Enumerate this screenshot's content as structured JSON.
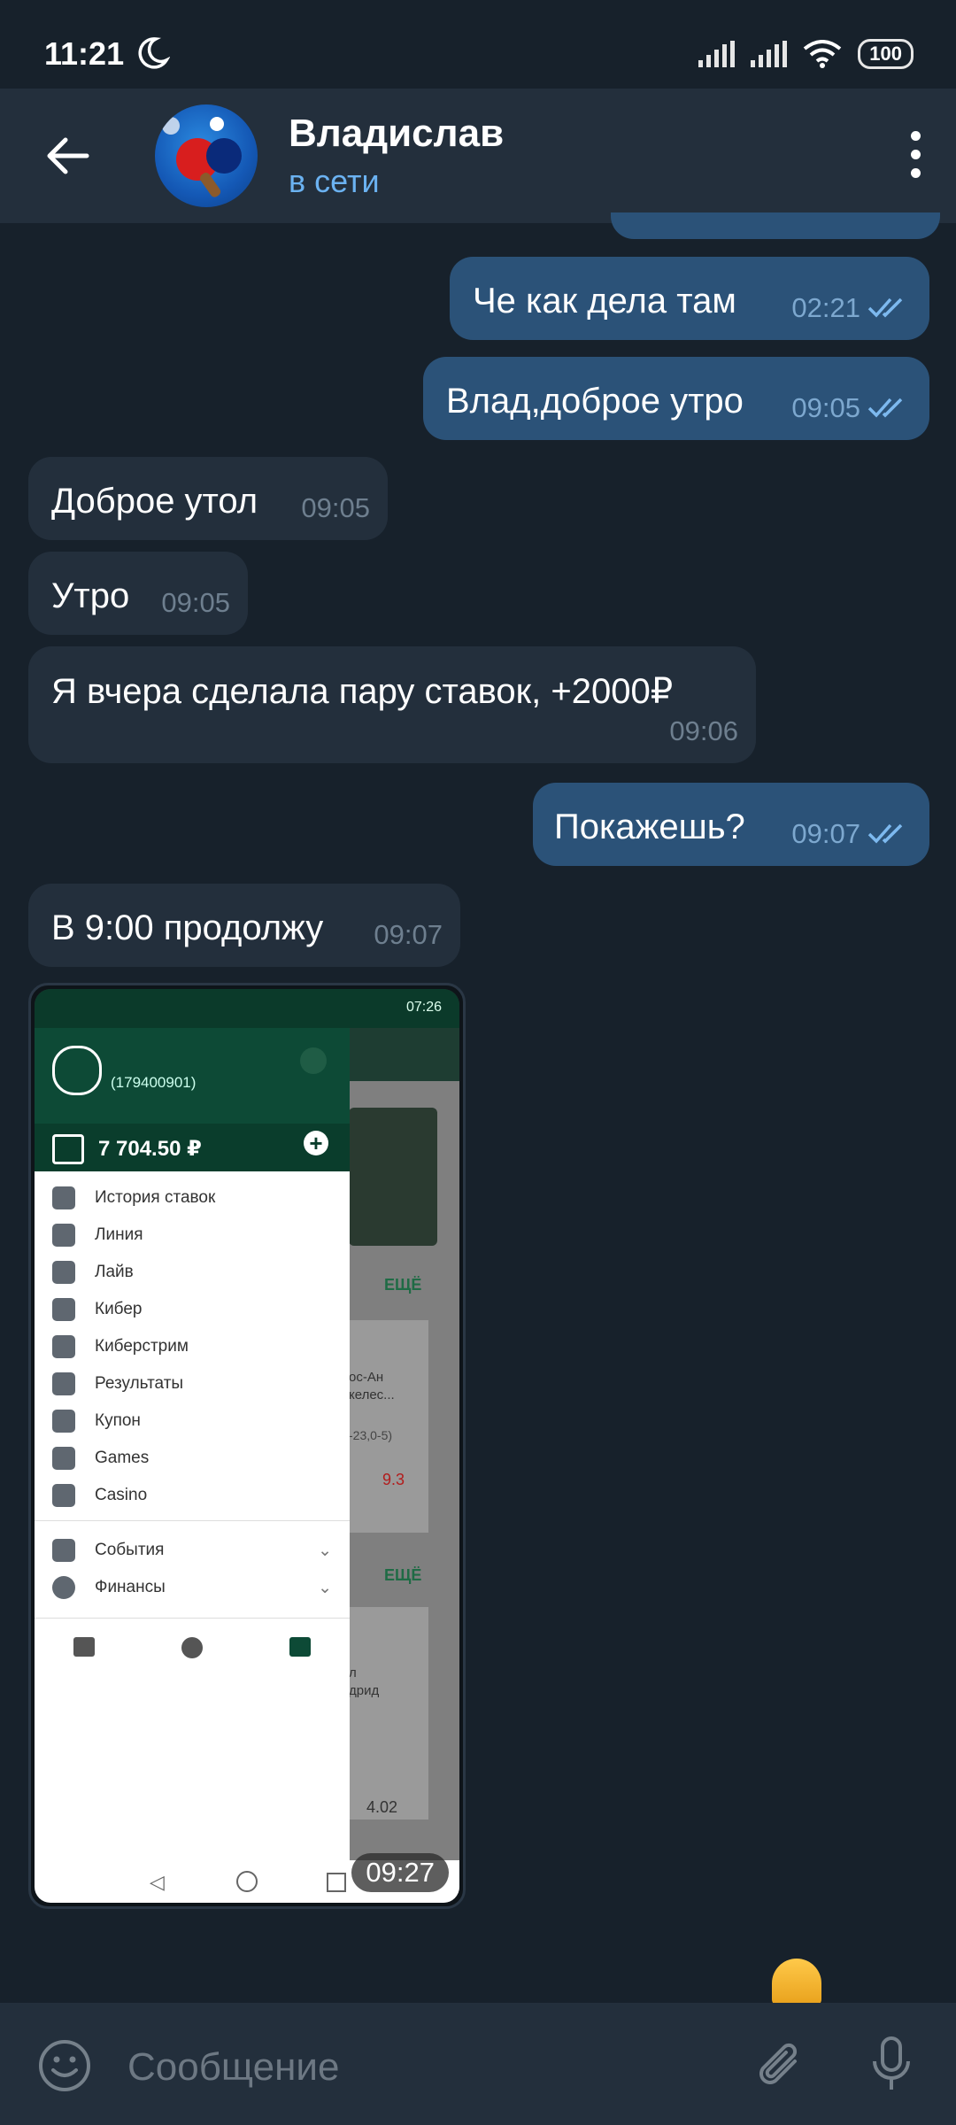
{
  "status_bar": {
    "time": "11:21",
    "battery": "100"
  },
  "header": {
    "name": "Владислав",
    "status": "в сети"
  },
  "messages": [
    {
      "dir": "out",
      "text": "Че как дела там",
      "time": "02:21"
    },
    {
      "dir": "out",
      "text": "Влад,доброе утро",
      "time": "09:05"
    },
    {
      "dir": "in",
      "text": "Доброе утол",
      "time": "09:05"
    },
    {
      "dir": "in",
      "text": "Утро",
      "time": "09:05"
    },
    {
      "dir": "in",
      "text": "Я вчера сделала пару ставок, +2000₽",
      "time": "09:06"
    },
    {
      "dir": "out",
      "text": "Покажешь?",
      "time": "09:07"
    },
    {
      "dir": "in",
      "text": "В 9:00 продолжу",
      "time": "09:07"
    }
  ],
  "screenshot": {
    "time": "09:27",
    "phone_time": "07:26",
    "account_id": "(179400901)",
    "balance": "7 704.50 ₽",
    "menu": [
      "История ставок",
      "Линия",
      "Лайв",
      "Кибер",
      "Киберстрим",
      "Результаты",
      "Купон",
      "Games",
      "Casino",
      "События",
      "Финансы"
    ],
    "side_ещё_1": "ЕЩЁ",
    "side_ещё_2": "ЕЩЁ",
    "side_text_1": "ос-Ан",
    "side_text_2": "келес...",
    "side_text_3": "-23,0-5)",
    "side_odd_1": "9.3",
    "side_text_4": "л",
    "side_text_5": "дрид",
    "side_odd_2": "4.02"
  },
  "composer": {
    "placeholder": "Сообщение"
  },
  "colors": {
    "background": "#17212b",
    "outgoing": "#2b5278",
    "incoming": "#232f3c",
    "accent": "#6bb2f1"
  }
}
